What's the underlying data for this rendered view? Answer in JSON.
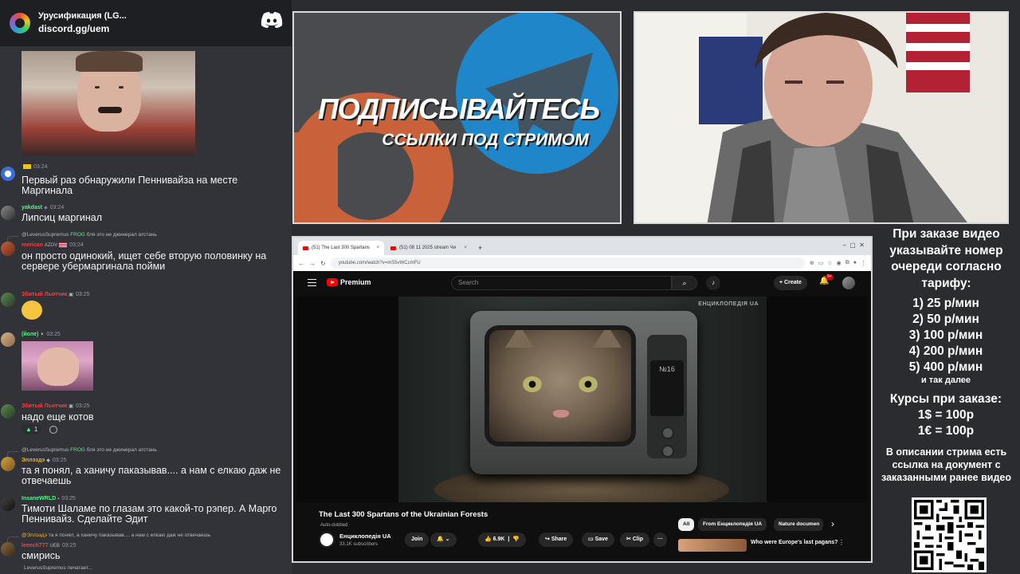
{
  "discord": {
    "server_name": "Урусификация (LG...",
    "invite": "discord.gg/uem"
  },
  "messages": [
    {
      "username": "",
      "name_color": "#f0b232",
      "time": "03:24",
      "text": "Первый раз обнаружили Пеннивайза на месте Маргинала"
    },
    {
      "username": "yakdast",
      "name_color": "#57f287",
      "time": "03:24",
      "text": "Липсиц маргинал"
    },
    {
      "reply_user": "@LeverusSupremus",
      "reply_badge": "FROG",
      "reply_text": "бля это не джинерал атстань",
      "username": "merican",
      "name_color": "#f23f43",
      "badge": "AZOV",
      "time": "03:24",
      "text": "он просто одинокий, ищет себе вторую половинку на сервере убермаргинала пойми"
    },
    {
      "username": "Збитый Льотчик",
      "name_color": "#f23f43",
      "time": "03:25",
      "text": ""
    },
    {
      "username": "(йоле)",
      "name_color": "#57f287",
      "time": "03:25",
      "text": ""
    },
    {
      "username": "Збитый Льотчик",
      "name_color": "#f23f43",
      "time": "03:25",
      "text": "надо еще котов",
      "reaction": "1"
    },
    {
      "reply_user": "@LeverusSupremus",
      "reply_badge": "FROG",
      "reply_text": "бля это не джинерал атстань",
      "username": "Эллэздэ",
      "name_color": "#f0b232",
      "time": "03:25",
      "text": "та я понял, а ханичу паказывав.... а нам с елкаю даж не отвечаешь"
    },
    {
      "username": "InsaneWRLD",
      "name_color": "#57f287",
      "time": "03:25",
      "text": "Тимоти Шаламе по глазам это какой-то рэпер. А Марго Пеннивайз. Сделайте Эдит"
    },
    {
      "reply_user": "@Эллэздэ",
      "reply_badge": "",
      "reply_text": "та я понял, а ханичу паказывав.... а нам с елкаю даж не отвечаешь",
      "username": "leeech777",
      "name_color": "#f23f43",
      "badge": "UEB",
      "time": "03:25",
      "text": "смирись"
    }
  ],
  "typing": "LeverusSupremus печатает...",
  "banner": {
    "title": "ПОДПИСЫВАЙТЕСЬ",
    "subtitle": "ССЫЛКИ ПОД СТРИМОМ"
  },
  "browser": {
    "tabs": [
      {
        "label": "(51) The Last 300 Spartans",
        "active": true
      },
      {
        "label": "(51) 08 11 2025 stream Чи",
        "active": false
      }
    ],
    "url": "youtube.com/watch?v=mS5vWCcmFU"
  },
  "youtube": {
    "logo": "Premium",
    "search_placeholder": "Search",
    "create_label": "Create",
    "notifications": "9+",
    "watermark": "ЕНЦИКЛОПЕДІЯ UA",
    "tv_number": "№16",
    "video_title": "The Last 300 Spartans of the Ukrainian Forests",
    "auto_dubbed": "Auto-dubbed",
    "channel_name": "Енциклопедія UA",
    "subscribers": "33.1K subscribers",
    "join_label": "Join",
    "bell_label": "🔔 ⌄",
    "likes": "6.9K",
    "share_label": "Share",
    "save_label": "Save",
    "clip_label": "Clip",
    "more_label": "···",
    "chips": [
      "All",
      "From Енциклопедія UA",
      "Nature documen"
    ],
    "chip_next": "›",
    "recommended_title": "Who were Europe's last pagans?"
  },
  "info": {
    "order_text": "При заказе видео указывайте номер очереди согласно тарифу:",
    "tariffs": [
      "1) 25 р/мин",
      "2) 50 р/мин",
      "3) 100 р/мин",
      "4) 200 р/мин",
      "5) 400 р/мин"
    ],
    "and_so_on": "и так далее",
    "rates_title": "Курсы при заказе:",
    "rates": [
      "1$ = 100р",
      "1€ = 100р"
    ],
    "description_text": "В описании стрима есть ссылка на документ с заказанными ранее видео"
  },
  "colors": {
    "discord_bg": "#313338",
    "youtube_red": "#ff0000",
    "banner_orange": "#c9613a",
    "banner_blue": "#1f86c9"
  }
}
